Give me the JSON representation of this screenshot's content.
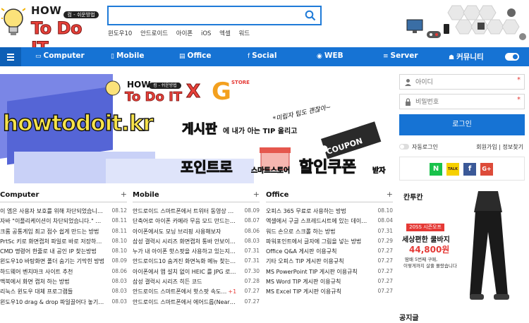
{
  "header": {
    "logo_how": "HOW",
    "logo_tag": "컴 - 쉬운방법",
    "logo_todo": "To Do IT",
    "search_value": "",
    "quick_links": [
      "윈도우10",
      "안드로이드",
      "아이폰",
      "iOS",
      "엑셀",
      "워드"
    ]
  },
  "nav": {
    "items": [
      {
        "icon": "monitor-icon",
        "label": "Computer"
      },
      {
        "icon": "phone-icon",
        "label": "Mobile"
      },
      {
        "icon": "document-icon",
        "label": "Office"
      },
      {
        "icon": "facebook-icon",
        "label": "Social"
      },
      {
        "icon": "chrome-icon",
        "label": "WEB"
      },
      {
        "icon": "server-icon",
        "label": "Server"
      },
      {
        "icon": "community-icon",
        "label": "커뮤니티"
      }
    ]
  },
  "banner": {
    "logo_how": "HOW",
    "logo_tag": "컴 - 쉬운방법",
    "logo_todo": "To Do IT",
    "x": "X",
    "partner_name": "G",
    "partner_sub": "STORE",
    "site": "howtodoit.kr",
    "line1a": "게시판",
    "line1b": "에 내가 아는 TIP 올리고",
    "handwriting": "*미립자 팁도 괜찮아~",
    "line2a": "포인트로",
    "line2b": "스마트스토어",
    "line2c": "할인쿠폰",
    "line2d": "받자",
    "coupon": "COUPON"
  },
  "login": {
    "id_placeholder": "아이디",
    "pw_placeholder": "비밀번호",
    "button": "로그인",
    "auto_login": "자동로그인",
    "join": "회원가입",
    "sep": "|",
    "find": "정보찾기",
    "social": [
      {
        "name": "naver",
        "label": "N",
        "color": "#19c24b"
      },
      {
        "name": "kakao",
        "label": "TALK",
        "color": "#f6d000"
      },
      {
        "name": "facebook",
        "label": "f",
        "color": "#3b5998"
      },
      {
        "name": "google",
        "label": "G+",
        "color": "#dd4b39"
      }
    ]
  },
  "ad": {
    "brand": "칸투칸",
    "badge": "20SS 시즌오프",
    "title": "세상편한 쿨바지",
    "price": "44,800원",
    "sub1": "땀배 5번째 구매,",
    "sub2": "이렇게까지 살줄 몰랐습니다"
  },
  "notice_title": "공지글",
  "columns": [
    {
      "title": "Computer",
      "posts": [
        {
          "text": "이 엠은 사용자 보호를 위해 차단되었습니다…",
          "cnt": "",
          "date": "08.12"
        },
        {
          "text": "자바 \"이플리케이션이 차단되었습니다.\" 해…",
          "cnt": "",
          "date": "08.11"
        },
        {
          "text": "크롬 공통게임 최고 점수 쉽게 만드는 방법",
          "cnt": "",
          "date": "08.11"
        },
        {
          "text": "PrtSc 키로 화면캡처 파일로 바로 저장하는…",
          "cnt": "",
          "date": "08.10"
        },
        {
          "text": "CMD 명령어 한줄로 내 공인 IP 찾는방법",
          "cnt": "",
          "date": "08.10"
        },
        {
          "text": "윈도우10 바탕화면 폴더 숨기는 기막힌 방법",
          "cnt": "",
          "date": "08.09"
        },
        {
          "text": "하드웨어 벤치마크 사이트 추천",
          "cnt": "",
          "date": "08.06"
        },
        {
          "text": "맥북에서 화면 캡처 하는 방법",
          "cnt": "",
          "date": "08.03"
        },
        {
          "text": "리눅스 윈도우 대체 프로그램들",
          "cnt": "",
          "date": "08.03"
        },
        {
          "text": "윈도우10 drag & drop 파일끌어다 놓기 …",
          "cnt": "",
          "date": "08.03"
        }
      ]
    },
    {
      "title": "Mobile",
      "posts": [
        {
          "text": "안드로이드 스마트폰에서 트위터 동영상 다…",
          "cnt": "",
          "date": "08.09"
        },
        {
          "text": "단축어로 아이폰 카메라 무음 모드 만드는 …",
          "cnt": "",
          "date": "08.07"
        },
        {
          "text": "아이폰에서도 모닝 브리핑 사용해보자",
          "cnt": "",
          "date": "08.06"
        },
        {
          "text": "삼성 갤럭시 시리즈 화면캡처 통바 안보이…",
          "cnt": "",
          "date": "08.03"
        },
        {
          "text": "누가 내 아이폰 핫스팟을 사용하고 있는지 …",
          "cnt": "",
          "date": "07.31"
        },
        {
          "text": "안드로이드10 숨겨진 화면녹화 메뉴 찾는 …",
          "cnt": "",
          "date": "07.31"
        },
        {
          "text": "아이폰에서 앱 설치 없이 HEIC 를 JPG 로 …",
          "cnt": "",
          "date": "07.30"
        },
        {
          "text": "삼성 갤럭시 시리즈 히든 코드",
          "cnt": "",
          "date": "07.28"
        },
        {
          "text": "안드로이드 스마트폰에서 핫스팟 속도…",
          "cnt": "+1",
          "date": "07.27"
        },
        {
          "text": "안드로이드 스마트폰에서 에어드롭(Nearb…",
          "cnt": "",
          "date": "07.27"
        }
      ]
    },
    {
      "title": "Office",
      "posts": [
        {
          "text": "오피스 365 무료로 사용하는 방법",
          "cnt": "",
          "date": "08.10"
        },
        {
          "text": "엑셀에서 구글 스프레드시트에 있는 데이터…",
          "cnt": "",
          "date": "08.04"
        },
        {
          "text": "워드 손으로 스크롤 하는 방법",
          "cnt": "",
          "date": "07.31"
        },
        {
          "text": "파워포인트에서 글자에 그림을 넣는 방법",
          "cnt": "",
          "date": "07.29"
        },
        {
          "text": "Office Q&A 게시판 이용규칙",
          "cnt": "",
          "date": "07.27"
        },
        {
          "text": "기타 오피스 TIP 게시판 이용규칙",
          "cnt": "",
          "date": "07.27"
        },
        {
          "text": "MS PowerPoint TIP 게시판 이용규칙",
          "cnt": "",
          "date": "07.27"
        },
        {
          "text": "MS Word TIP 게시판 이용규칙",
          "cnt": "",
          "date": "07.27"
        },
        {
          "text": "MS Excel TIP 게시판 이용규칙",
          "cnt": "",
          "date": "07.27"
        }
      ]
    }
  ]
}
